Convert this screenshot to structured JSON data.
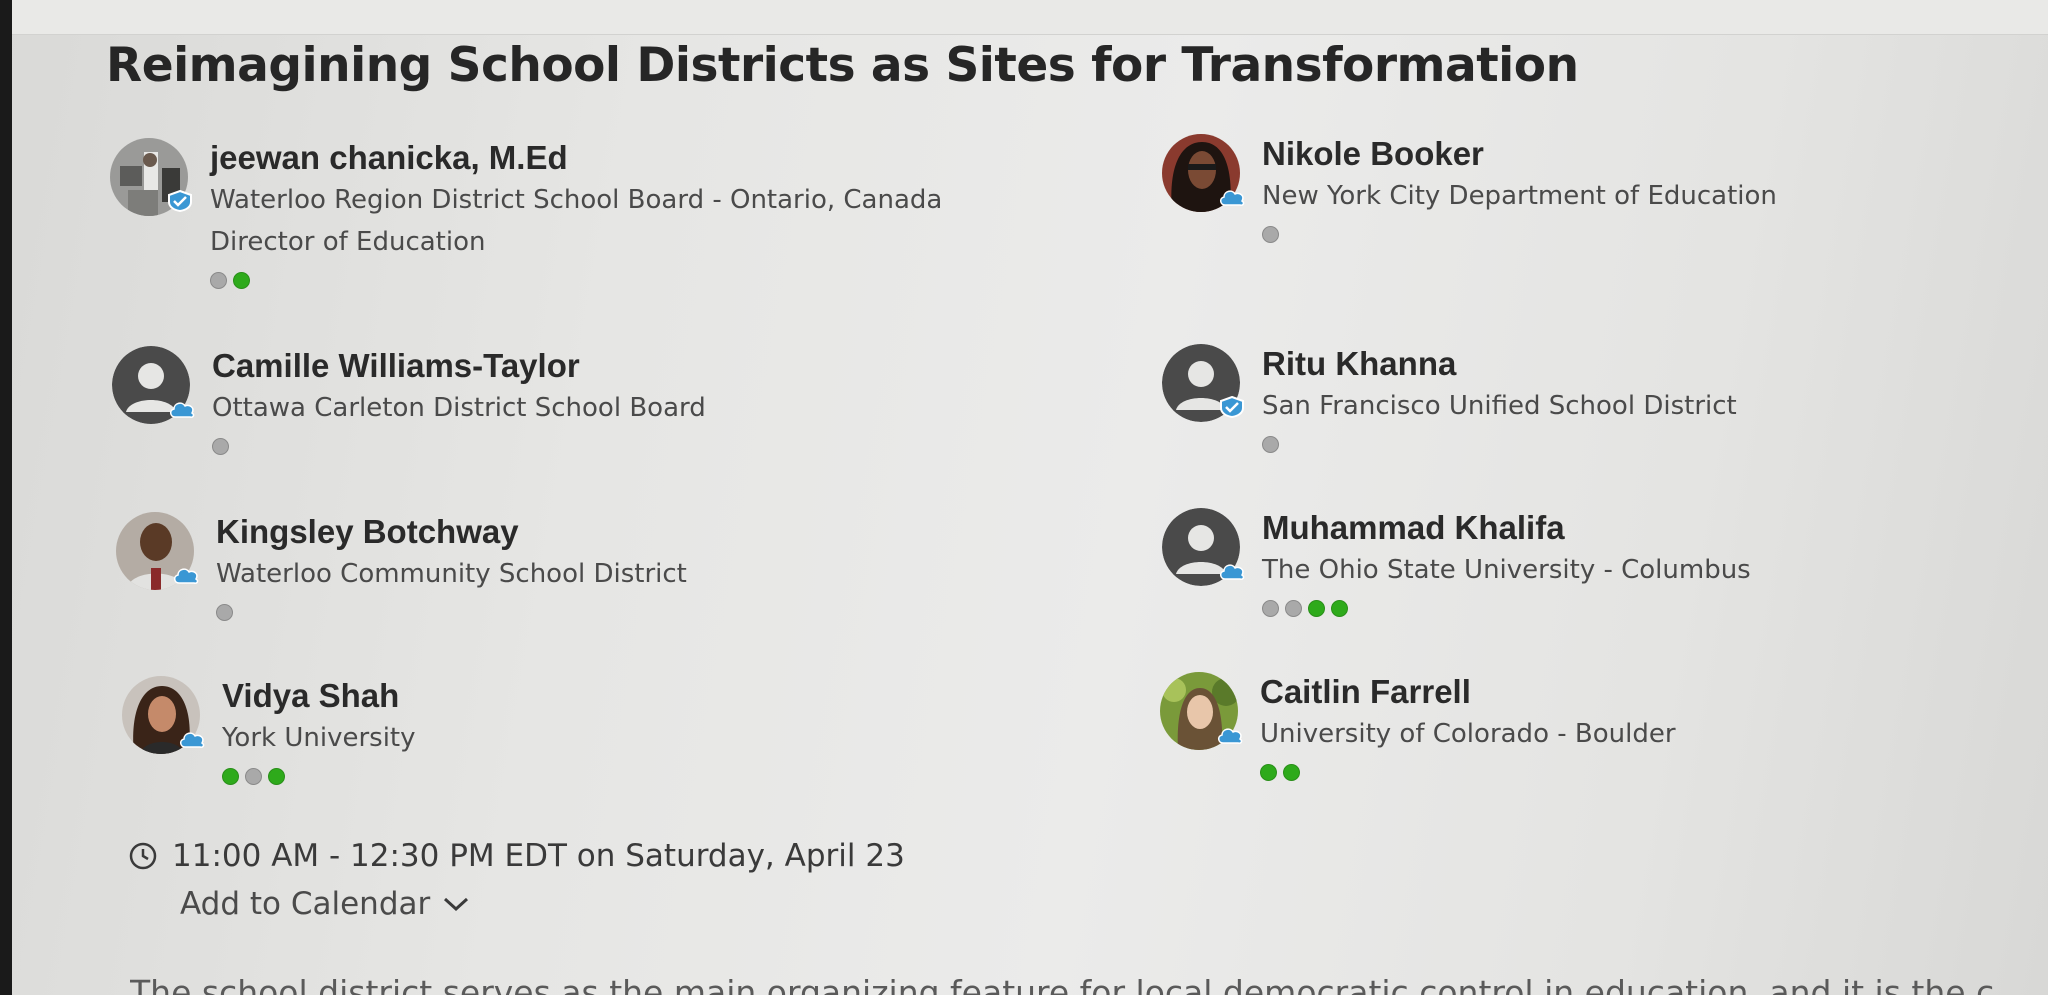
{
  "session": {
    "title": "Reimagining School Districts as Sites for Transformation",
    "time": "11:00 AM - 12:30 PM EDT on Saturday, April 23",
    "add_to_calendar": "Add to Calendar",
    "description": "The school district serves as the main organizing feature for local democratic control in education, and it is the c"
  },
  "speakers": [
    {
      "name": "jeewan chanicka, M.Ed",
      "org": "Waterloo Region District School Board - Ontario, Canada",
      "role": "Director of Education",
      "avatar": "photo",
      "badge": "verified-icon",
      "dots": [
        "gray",
        "green"
      ]
    },
    {
      "name": "Nikole Booker",
      "org": "New York City Department of Education",
      "avatar": "photo",
      "badge": "cloud-icon",
      "dots": [
        "gray"
      ]
    },
    {
      "name": "Camille Williams-Taylor",
      "org": "Ottawa Carleton District School Board",
      "avatar": "placeholder",
      "badge": "cloud-icon",
      "dots": [
        "gray"
      ]
    },
    {
      "name": "Ritu Khanna",
      "org": "San Francisco Unified School District",
      "avatar": "placeholder",
      "badge": "verified-icon",
      "dots": [
        "gray"
      ]
    },
    {
      "name": "Kingsley Botchway",
      "org": "Waterloo Community School District",
      "avatar": "photo",
      "badge": "cloud-icon",
      "dots": [
        "gray"
      ]
    },
    {
      "name": "Muhammad Khalifa",
      "org": "The Ohio State University - Columbus",
      "avatar": "placeholder",
      "badge": "cloud-icon",
      "dots": [
        "gray",
        "gray",
        "green",
        "green"
      ]
    },
    {
      "name": "Vidya Shah",
      "org": "York University",
      "avatar": "photo",
      "badge": "cloud-icon",
      "dots": [
        "green",
        "gray",
        "green"
      ]
    },
    {
      "name": "Caitlin Farrell",
      "org": "University of Colorado - Boulder",
      "avatar": "photo",
      "badge": "cloud-icon",
      "dots": [
        "green",
        "green"
      ]
    }
  ],
  "colors": {
    "dot_green": "#2eaa1b",
    "dot_gray": "#a9a9a9",
    "badge_blue": "#3a97d4",
    "placeholder_dark": "#4a4a4a"
  },
  "icons": {
    "clock": "clock-icon",
    "chevron": "chevron-down-icon"
  }
}
